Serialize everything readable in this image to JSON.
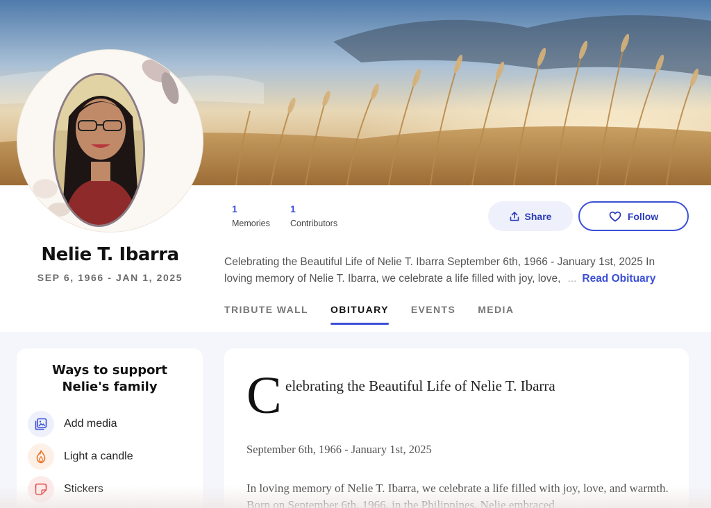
{
  "profile": {
    "name": "Nelie T. Ibarra",
    "dates": "SEP 6, 1966 - JAN 1, 2025"
  },
  "stats": [
    {
      "value": "1",
      "label": "Memories"
    },
    {
      "value": "1",
      "label": "Contributors"
    }
  ],
  "actions": {
    "share_label": "Share",
    "follow_label": "Follow"
  },
  "summary": {
    "line1": "Celebrating the Beautiful Life of Nelie T. Ibarra September 6th, 1966 - January 1st, 2025 In",
    "line2": "loving memory of Nelie T. Ibarra, we celebrate a life filled with joy, love,",
    "ellipsis": "...",
    "read_more": "Read Obituary"
  },
  "tabs": [
    {
      "label": "TRIBUTE WALL",
      "active": false
    },
    {
      "label": "OBITUARY",
      "active": true
    },
    {
      "label": "EVENTS",
      "active": false
    },
    {
      "label": "MEDIA",
      "active": false
    }
  ],
  "support": {
    "title_line1": "Ways to support",
    "title_line2": "Nelie's family",
    "items": [
      {
        "label": "Add media",
        "icon": "image-gallery-icon",
        "color": "#3b4fd6"
      },
      {
        "label": "Light a candle",
        "icon": "candle-flame-icon",
        "color": "#e8772e"
      },
      {
        "label": "Stickers",
        "icon": "sticker-icon",
        "color": "#e0443e"
      }
    ]
  },
  "obituary": {
    "dropcap": "C",
    "title_rest": "elebrating the Beautiful Life of Nelie T. Ibarra",
    "date_range": "September 6th, 1966 - January 1st, 2025",
    "body": "In loving memory of Nelie T. Ibarra, we celebrate a life filled with joy, love, and warmth. Born on September 6th, 1966, in the Philippines, Nelie embraced"
  },
  "colors": {
    "accent": "#3b4fd6",
    "background": "#f5f6fb"
  }
}
